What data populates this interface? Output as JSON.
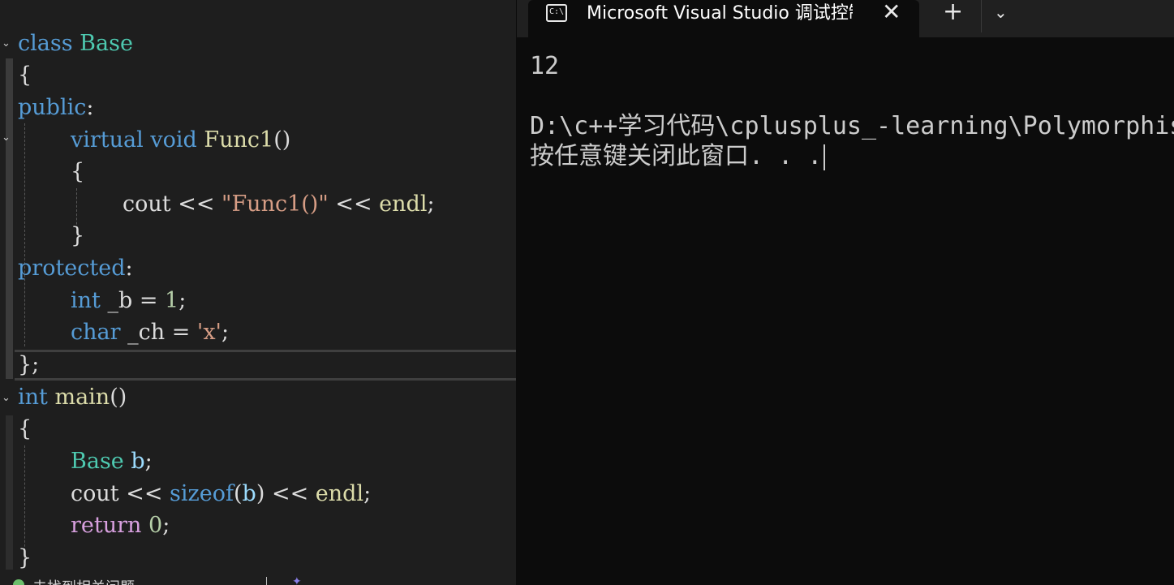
{
  "editor": {
    "code": {
      "l1": {
        "kw": "class",
        "name": "Base"
      },
      "l2": "{",
      "l3": {
        "kw": "public",
        "punct": ":"
      },
      "l4": {
        "kw": "virtual",
        "type": "void",
        "fn": "Func1",
        "rest": "()"
      },
      "l5": "{",
      "l6": {
        "a": "cout << ",
        "str": "\"Func1()\"",
        "b": " << ",
        "fn": "endl",
        "c": ";"
      },
      "l7": "}",
      "l8": {
        "kw": "protected",
        "punct": ":"
      },
      "l9": {
        "kw": "int",
        "a": " _b = ",
        "num": "1",
        "c": ";"
      },
      "l10": {
        "kw": "char",
        "a": " _ch = ",
        "str": "'x'",
        "c": ";"
      },
      "l11": "};",
      "l12": {
        "kw": "int",
        "fn": "main",
        "rest": "()"
      },
      "l13": "{",
      "l14": {
        "type": "Base",
        "var": "b",
        "c": ";"
      },
      "l15": {
        "a": "cout << ",
        "kw": "sizeof",
        "p1": "(",
        "var": "b",
        "p2": ")",
        "b": " << ",
        "fn": "endl",
        "c": ";"
      },
      "l16": {
        "ctl": "return",
        "num": "0",
        "c": ";"
      },
      "l17": "}"
    },
    "status": {
      "text": "未找到相关问题"
    }
  },
  "terminal": {
    "tab_title": "Microsoft Visual Studio 调试控制台",
    "tab_close": "✕",
    "new_tab": "+",
    "dropdown": "⌄",
    "icon_label": "C:\\",
    "output": [
      "12",
      "",
      "D:\\c++学习代码\\cplusplus_-learning\\Polymorphism",
      "按任意键关闭此窗口. . ."
    ]
  },
  "colors": {
    "editor_bg": "#1e1e1e",
    "terminal_bg": "#0c0c0c",
    "keyword": "#569cd6",
    "type": "#4ec9b0",
    "function": "#dcdcaa",
    "string": "#d69d85",
    "number": "#b5cea8",
    "control": "#d8a0df",
    "variable": "#9cdcfe"
  }
}
